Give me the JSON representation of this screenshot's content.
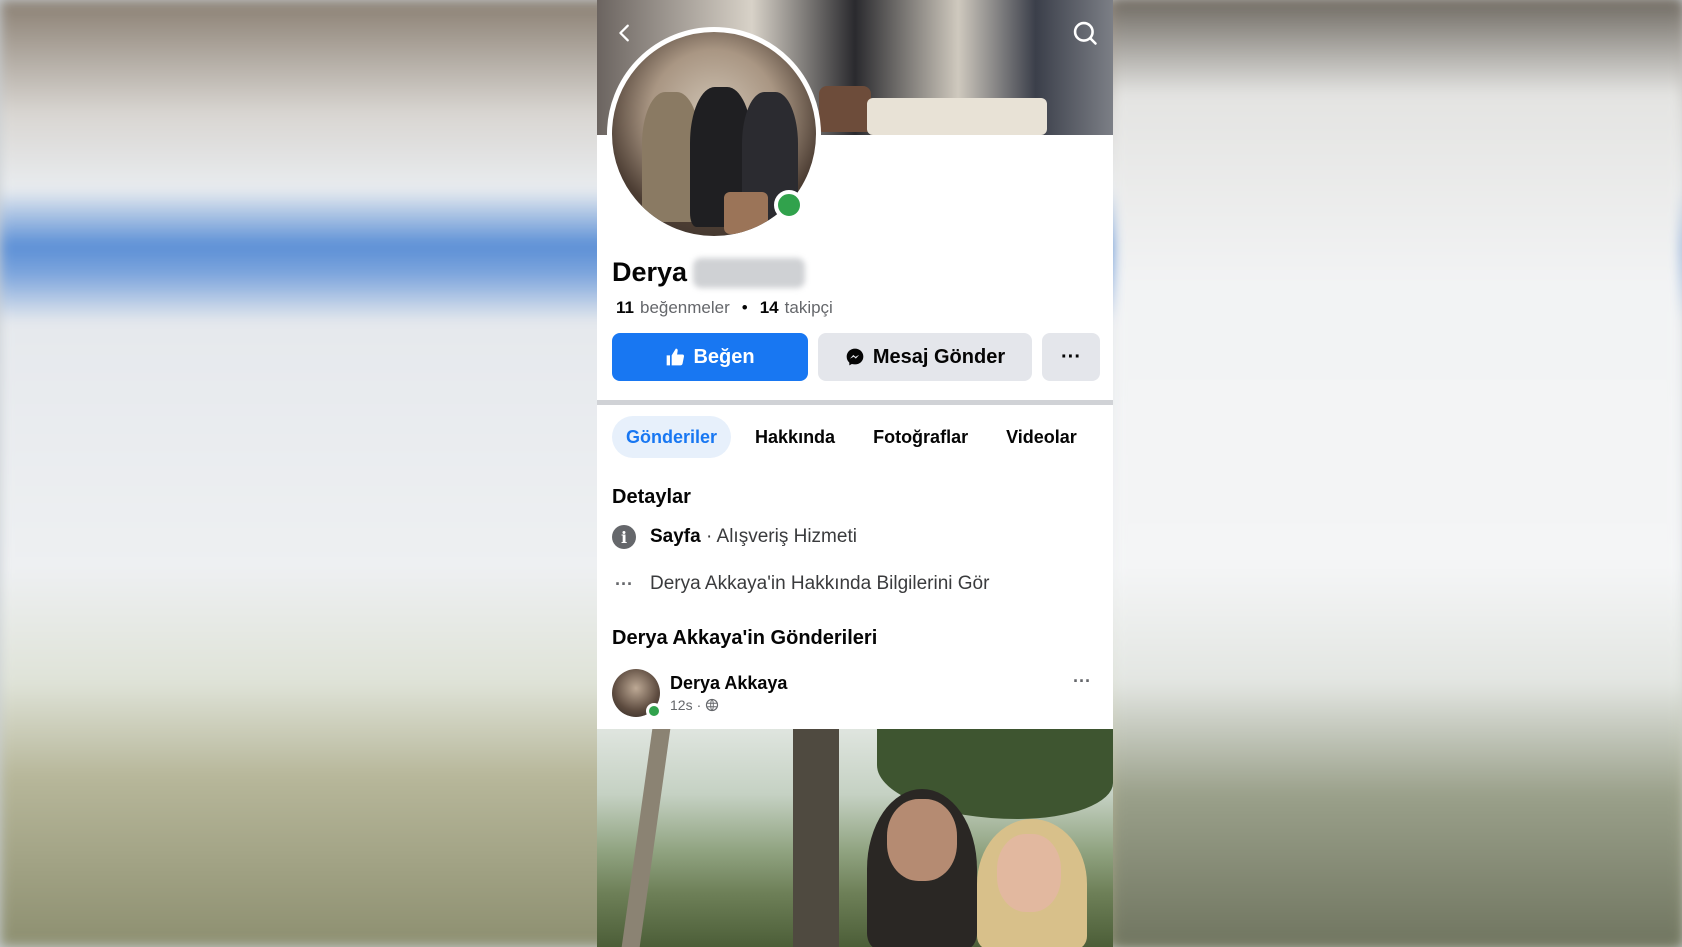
{
  "profile": {
    "first_name": "Derya",
    "likes_count": "11",
    "likes_label": "beğenmeler",
    "followers_count": "14",
    "followers_label": "takipçi"
  },
  "actions": {
    "like_label": "Beğen",
    "message_label": "Mesaj Gönder",
    "more_label": "···"
  },
  "tabs": [
    {
      "label": "Gönderiler",
      "active": true
    },
    {
      "label": "Hakkında",
      "active": false
    },
    {
      "label": "Fotoğraflar",
      "active": false
    },
    {
      "label": "Videolar",
      "active": false
    }
  ],
  "details": {
    "title": "Detaylar",
    "page_type_strong": "Sayfa",
    "page_type_rest": "· Alışveriş Hizmeti",
    "about_link": "Derya Akkaya'in Hakkında Bilgilerini Gör"
  },
  "posts_section": {
    "title": "Derya Akkaya'in Gönderileri"
  },
  "post": {
    "author": "Derya Akkaya",
    "time": "12s",
    "separator": "·"
  },
  "icons": {
    "back": "chevron-left-icon",
    "search": "search-icon",
    "like": "thumbs-up-icon",
    "messenger": "messenger-icon",
    "info": "info-icon",
    "more": "ellipsis-icon",
    "globe": "globe-icon"
  },
  "colors": {
    "brand_blue": "#1877f2",
    "online_green": "#31a24c",
    "secondary_button": "#e4e6eb",
    "active_tab_bg": "#e7f0fb"
  }
}
